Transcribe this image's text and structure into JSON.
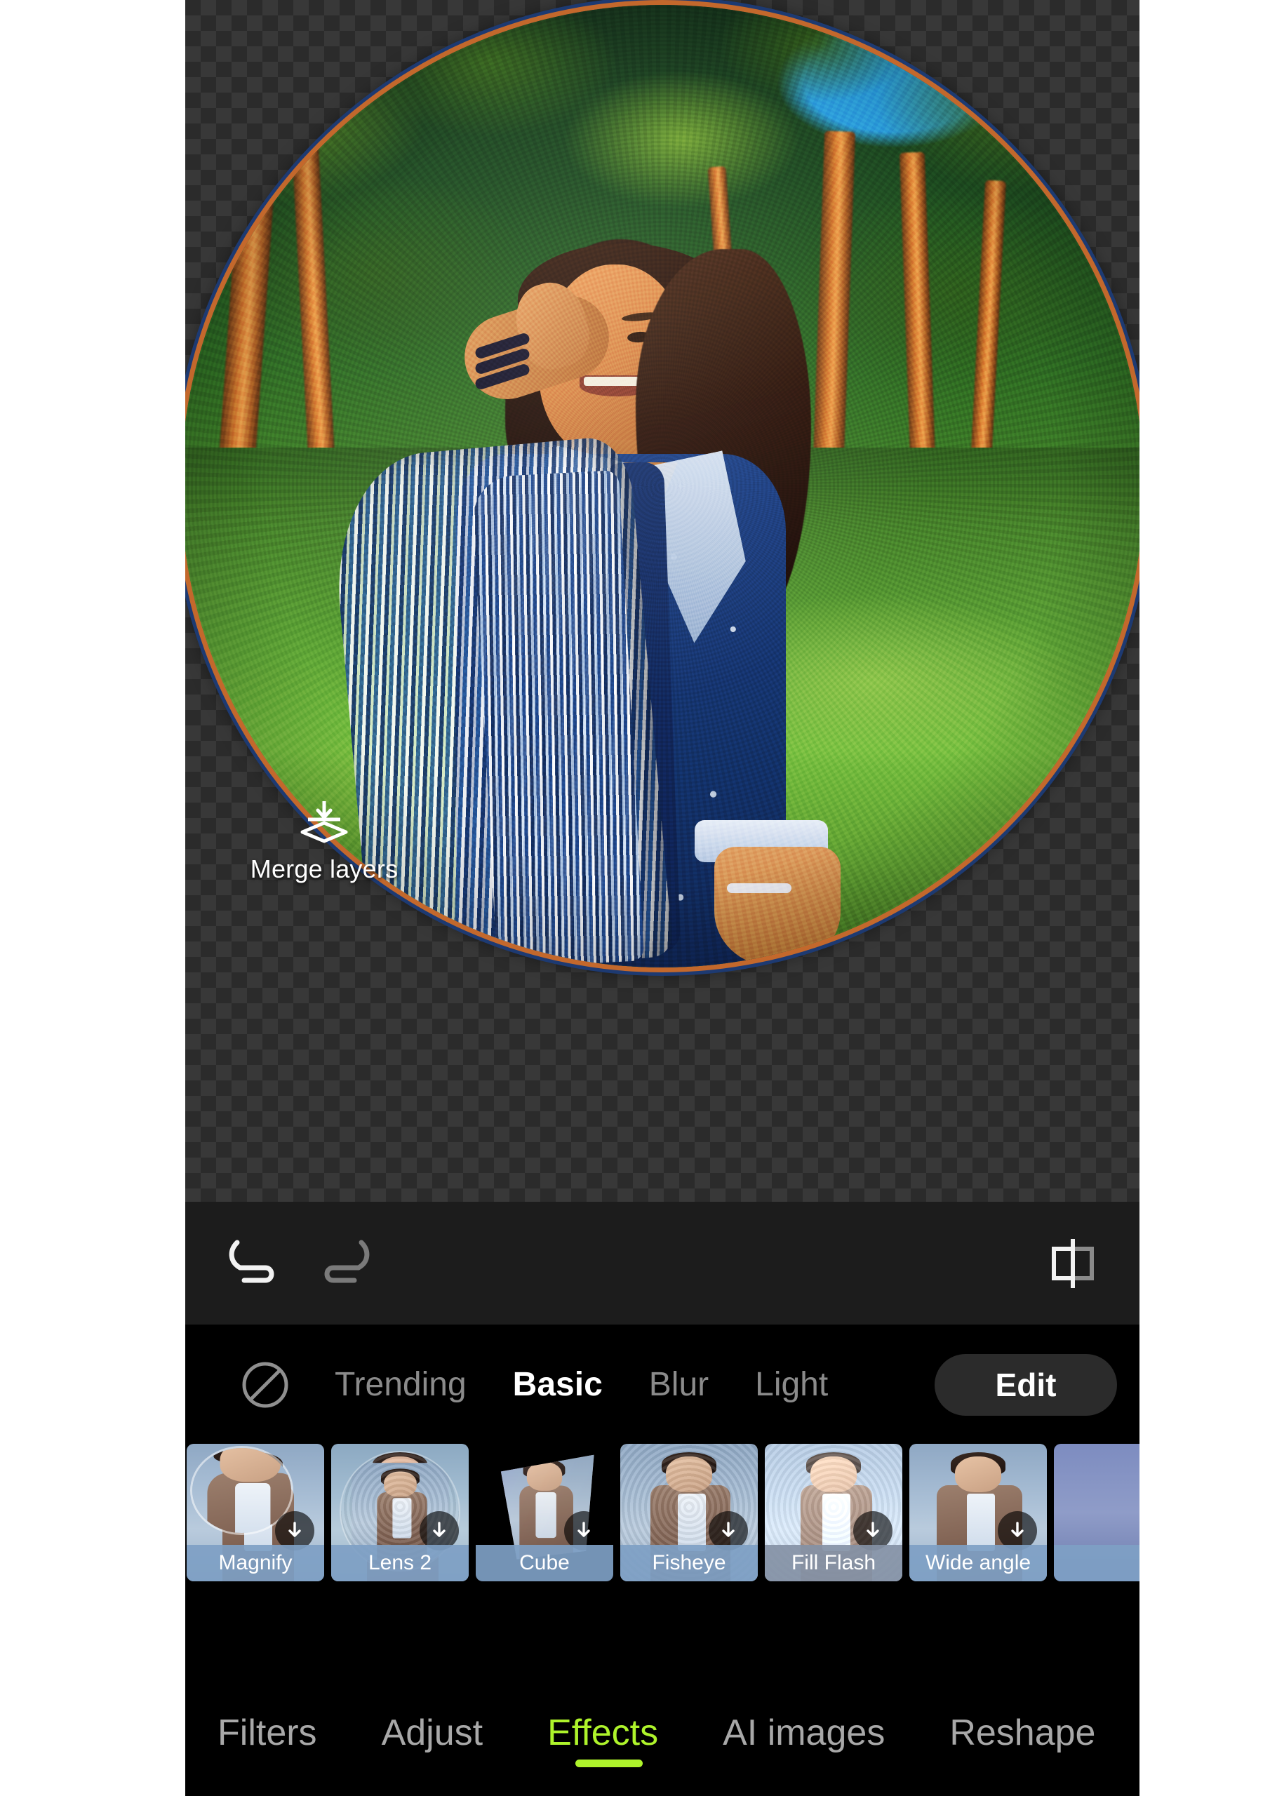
{
  "app": {
    "name": "photo-editor",
    "accent_green": "#aef32b",
    "panel_black": "#000000",
    "toolbar_gray": "#1c1c1c",
    "label_blue": "#7ea0c4"
  },
  "canvas": {
    "transparency_checker": true,
    "effect_applied": "fisheye-sphere",
    "rim_color": "#c3682c",
    "overlay_control": {
      "icon": "merge-layers-icon",
      "label": "Merge layers"
    }
  },
  "toolbar": {
    "undo": {
      "icon": "undo-icon",
      "label": "Undo",
      "enabled": true
    },
    "redo": {
      "icon": "redo-icon",
      "label": "Redo",
      "enabled": false
    },
    "compare": {
      "icon": "compare-before-after-icon",
      "label": "Compare"
    }
  },
  "effects_panel": {
    "none_icon": "no-effect-icon",
    "categories": [
      {
        "label": "Trending",
        "active": false
      },
      {
        "label": "Basic",
        "active": true
      },
      {
        "label": "Blur",
        "active": false
      },
      {
        "label": "Light",
        "active": false
      }
    ],
    "edit_button": "Edit",
    "thumbnails": [
      {
        "label": "Magnify",
        "style": "magnify",
        "badge": "download-icon",
        "label_muted": false
      },
      {
        "label": "Lens 2",
        "style": "lens",
        "badge": "download-icon",
        "label_muted": false
      },
      {
        "label": "Cube",
        "style": "cube",
        "badge": "download-icon",
        "label_muted": false
      },
      {
        "label": "Fisheye",
        "style": "plain",
        "badge": "download-icon",
        "label_muted": false
      },
      {
        "label": "Fill Flash",
        "style": "fill",
        "badge": "download-icon",
        "label_muted": true
      },
      {
        "label": "Wide angle",
        "style": "plain",
        "badge": "download-icon",
        "label_muted": false
      },
      {
        "label": "",
        "style": "plain",
        "badge": "",
        "label_muted": false
      }
    ]
  },
  "bottom_nav": {
    "items": [
      {
        "label": "Filters",
        "active": false
      },
      {
        "label": "Adjust",
        "active": false
      },
      {
        "label": "Effects",
        "active": true
      },
      {
        "label": "AI images",
        "active": false
      },
      {
        "label": "Reshape",
        "active": false
      }
    ]
  }
}
